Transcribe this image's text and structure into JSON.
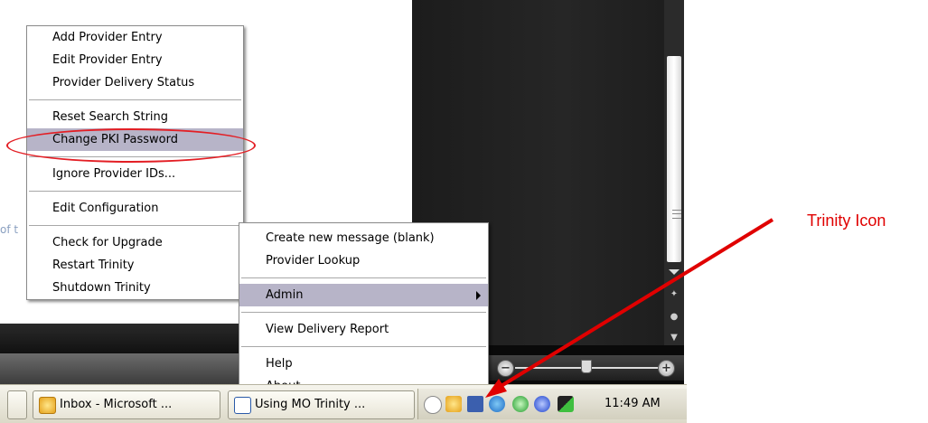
{
  "admin_menu": {
    "items": [
      {
        "label": "Add Provider Entry"
      },
      {
        "label": "Edit Provider Entry"
      },
      {
        "label": "Provider Delivery Status"
      },
      {
        "label": "Reset Search String"
      },
      {
        "label": "Change PKI Password"
      },
      {
        "label": "Ignore Provider IDs..."
      },
      {
        "label": "Edit Configuration"
      },
      {
        "label": "Check for Upgrade"
      },
      {
        "label": "Restart Trinity"
      },
      {
        "label": "Shutdown Trinity"
      }
    ],
    "highlighted": "Change PKI Password"
  },
  "context_menu": {
    "items": [
      {
        "label": "Create new message (blank)"
      },
      {
        "label": "Provider Lookup"
      },
      {
        "label": "Admin"
      },
      {
        "label": "View Delivery Report"
      },
      {
        "label": "Help"
      },
      {
        "label": "About..."
      }
    ],
    "highlighted": "Admin"
  },
  "background": {
    "stub_text": "of t"
  },
  "taskbar": {
    "buttons": [
      {
        "label": "Inbox - Microsoft ...",
        "icon": "outlook-icon"
      },
      {
        "label": "Using MO Trinity ...",
        "icon": "document-icon"
      }
    ],
    "tray_icons": [
      "chevron-left-icon",
      "trinity-icon",
      "network-icon",
      "globe-icon",
      "sync-icon",
      "pulse-icon",
      "usb-drive-icon"
    ],
    "clock": "11:49 AM"
  },
  "annotation": {
    "label": "Trinity Icon",
    "color": "#e00000"
  },
  "colors": {
    "menu_highlight": "#b7b4c8",
    "ellipse": "#e31e24"
  }
}
